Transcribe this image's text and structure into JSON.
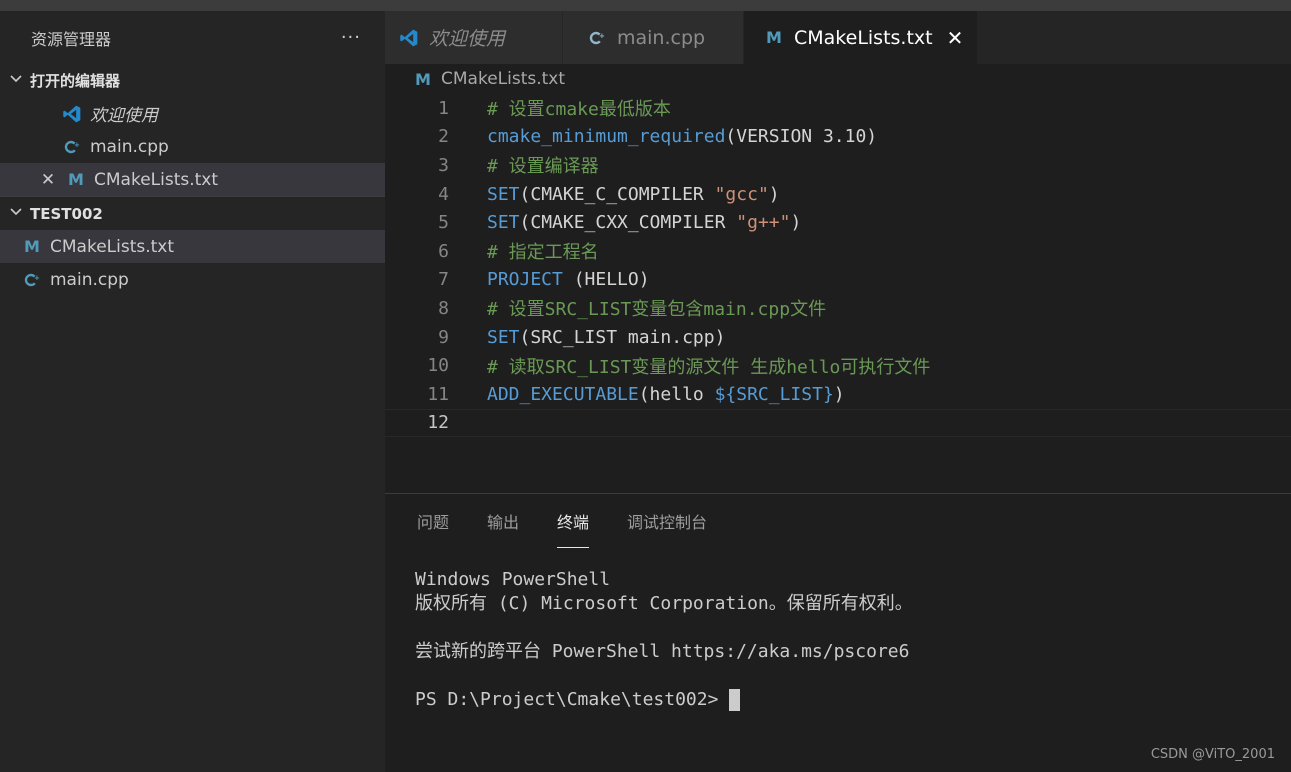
{
  "sidebar": {
    "title": "资源管理器",
    "more": "···",
    "open_editors": {
      "label": "打开的编辑器",
      "items": [
        {
          "label": "欢迎使用",
          "icon": "vscode-icon"
        },
        {
          "label": "main.cpp",
          "icon": "cpp-icon"
        },
        {
          "label": "CMakeLists.txt",
          "icon": "cmake-icon",
          "close": "✕"
        }
      ]
    },
    "folder": {
      "label": "TEST002",
      "items": [
        {
          "label": "CMakeLists.txt",
          "icon": "cmake-icon"
        },
        {
          "label": "main.cpp",
          "icon": "cpp-icon"
        }
      ]
    }
  },
  "editor": {
    "tabs": [
      {
        "label": "欢迎使用",
        "icon": "vscode-icon"
      },
      {
        "label": "main.cpp",
        "icon": "cpp-icon"
      },
      {
        "label": "CMakeLists.txt",
        "icon": "cmake-icon",
        "close": "✕"
      }
    ],
    "breadcrumb": "CMakeLists.txt",
    "lines": [
      {
        "n": "1",
        "tokens": [
          {
            "t": "# 设置cmake最低版本",
            "c": "com"
          }
        ]
      },
      {
        "n": "2",
        "tokens": [
          {
            "t": "cmake_minimum_required",
            "c": "fn"
          },
          {
            "t": "(VERSION 3.10)",
            "c": "txt"
          }
        ]
      },
      {
        "n": "3",
        "tokens": [
          {
            "t": "# 设置编译器",
            "c": "com"
          }
        ]
      },
      {
        "n": "4",
        "tokens": [
          {
            "t": "SET",
            "c": "fn"
          },
          {
            "t": "(CMAKE_C_COMPILER ",
            "c": "txt"
          },
          {
            "t": "\"gcc\"",
            "c": "str"
          },
          {
            "t": ")",
            "c": "txt"
          }
        ]
      },
      {
        "n": "5",
        "tokens": [
          {
            "t": "SET",
            "c": "fn"
          },
          {
            "t": "(CMAKE_CXX_COMPILER ",
            "c": "txt"
          },
          {
            "t": "\"g++\"",
            "c": "str"
          },
          {
            "t": ")",
            "c": "txt"
          }
        ]
      },
      {
        "n": "6",
        "tokens": [
          {
            "t": "# 指定工程名",
            "c": "com"
          }
        ]
      },
      {
        "n": "7",
        "tokens": [
          {
            "t": "PROJECT",
            "c": "fn"
          },
          {
            "t": " (HELLO)",
            "c": "txt"
          }
        ]
      },
      {
        "n": "8",
        "tokens": [
          {
            "t": "# 设置SRC_LIST变量包含main.cpp文件",
            "c": "com"
          }
        ]
      },
      {
        "n": "9",
        "tokens": [
          {
            "t": "SET",
            "c": "fn"
          },
          {
            "t": "(SRC_LIST main.cpp)",
            "c": "txt"
          }
        ]
      },
      {
        "n": "10",
        "tokens": [
          {
            "t": "# 读取SRC_LIST变量的源文件 生成hello可执行文件",
            "c": "com"
          }
        ]
      },
      {
        "n": "11",
        "tokens": [
          {
            "t": "ADD_EXECUTABLE",
            "c": "fn"
          },
          {
            "t": "(hello ",
            "c": "txt"
          },
          {
            "t": "${SRC_LIST}",
            "c": "var"
          },
          {
            "t": ")",
            "c": "txt"
          }
        ]
      },
      {
        "n": "12",
        "tokens": []
      }
    ]
  },
  "panel": {
    "tabs": [
      "问题",
      "输出",
      "终端",
      "调试控制台"
    ],
    "active_tab": 2,
    "terminal": [
      "Windows PowerShell",
      "版权所有 (C) Microsoft Corporation。保留所有权利。",
      "",
      "尝试新的跨平台 PowerShell https://aka.ms/pscore6",
      "",
      "PS D:\\Project\\Cmake\\test002> "
    ]
  },
  "watermark": "CSDN @ViTO_2001",
  "colors": {
    "comment": "#6a9955",
    "keyword": "#569cd6",
    "string": "#ce9178",
    "text": "#d4d4d4",
    "cmake_icon": "#519aba",
    "vscode_icon": "#2489ca"
  }
}
